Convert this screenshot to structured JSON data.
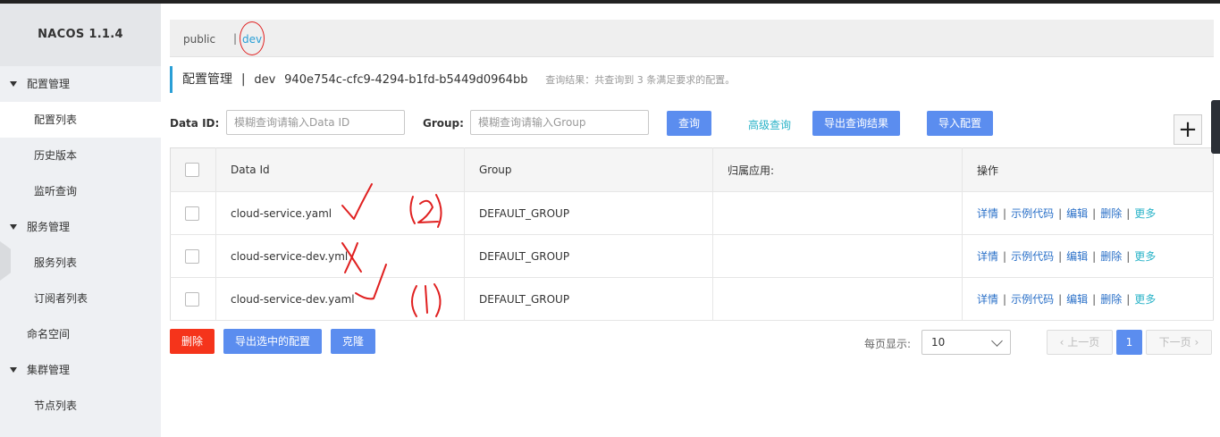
{
  "app": {
    "brand": "NACOS 1.1.4"
  },
  "sidebar": {
    "items": [
      {
        "label": "配置管理",
        "type": "group"
      },
      {
        "label": "配置列表",
        "type": "child",
        "active": true
      },
      {
        "label": "历史版本",
        "type": "child"
      },
      {
        "label": "监听查询",
        "type": "child"
      },
      {
        "label": "服务管理",
        "type": "group"
      },
      {
        "label": "服务列表",
        "type": "child"
      },
      {
        "label": "订阅者列表",
        "type": "child"
      },
      {
        "label": "命名空间",
        "type": "plain"
      },
      {
        "label": "集群管理",
        "type": "group"
      },
      {
        "label": "节点列表",
        "type": "child"
      }
    ]
  },
  "namespaces": {
    "public": "public",
    "separator": "|",
    "dev": "dev"
  },
  "header": {
    "title": "配置管理",
    "separator": "|",
    "namespace": "dev",
    "namespace_id": "940e754c-cfc9-4294-b1fd-b5449d0964bb",
    "result_hint": "查询结果：共查询到 3 条满足要求的配置。"
  },
  "filters": {
    "dataid_label": "Data ID:",
    "dataid_placeholder": "模糊查询请输入Data ID",
    "group_label": "Group:",
    "group_placeholder": "模糊查询请输入Group",
    "search_button": "查询",
    "advanced_link": "高级查询",
    "export_button": "导出查询结果",
    "import_button": "导入配置",
    "add_button": "+"
  },
  "table": {
    "columns": [
      "Data Id",
      "Group",
      "归属应用:",
      "操作"
    ],
    "rows": [
      {
        "data_id": "cloud-service.yaml",
        "group": "DEFAULT_GROUP",
        "app": ""
      },
      {
        "data_id": "cloud-service-dev.yml",
        "group": "DEFAULT_GROUP",
        "app": ""
      },
      {
        "data_id": "cloud-service-dev.yaml",
        "group": "DEFAULT_GROUP",
        "app": ""
      }
    ],
    "actions": {
      "detail": "详情",
      "sample": "示例代码",
      "edit": "编辑",
      "delete": "删除",
      "more": "更多",
      "sep": "|"
    }
  },
  "footer": {
    "delete_button": "删除",
    "export_selected_button": "导出选中的配置",
    "clone_button": "克隆",
    "page_size_label": "每页显示:",
    "page_size_value": "10",
    "prev_label": "上一页",
    "current_page": "1",
    "next_label": "下一页"
  },
  "annotations": {
    "color": "#e02020",
    "marks": [
      "(2)",
      "(1)"
    ]
  },
  "colors": {
    "primary": "#5b8def",
    "danger": "#f5341b",
    "link": "#2a9fd6",
    "sidebar_bg": "#eef0f3"
  }
}
